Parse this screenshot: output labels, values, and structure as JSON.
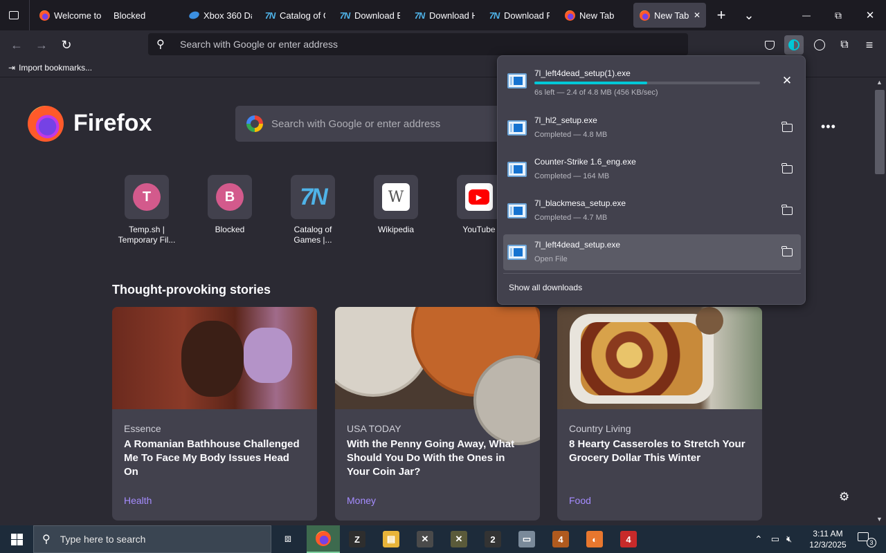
{
  "tabs": [
    {
      "label": "Welcome to",
      "icon": "firefox-icon"
    },
    {
      "label": "Blocked",
      "icon": "none"
    },
    {
      "label": "Xbox 360 Da",
      "icon": "xbox-icon"
    },
    {
      "label": "Catalog of G",
      "icon": "7n-icon"
    },
    {
      "label": "Download B",
      "icon": "7n-icon"
    },
    {
      "label": "Download H",
      "icon": "7n-icon"
    },
    {
      "label": "Download P",
      "icon": "7n-icon"
    },
    {
      "label": "New Tab",
      "icon": "firefox-icon"
    },
    {
      "label": "New Tab",
      "icon": "firefox-icon",
      "active": true
    }
  ],
  "window": {
    "minimize": "—",
    "maximize": "⧉",
    "close": "✕",
    "new_tab": "+",
    "tab_list": "⌄",
    "tab_close": "✕"
  },
  "nav": {
    "url_placeholder": "Search with Google or enter address"
  },
  "bookmarks": {
    "import_label": "Import bookmarks..."
  },
  "newtab": {
    "brand": "Firefox",
    "search_placeholder": "Search with Google or enter address",
    "top_sites": [
      {
        "label": "Temp.sh | Temporary Fil...",
        "letter": "T"
      },
      {
        "label": "Blocked",
        "letter": "B"
      },
      {
        "label": "Catalog of Games |...",
        "letter": "7N"
      },
      {
        "label": "Wikipedia",
        "letter": "W"
      },
      {
        "label": "YouTube",
        "letter": "▶"
      }
    ],
    "stories_heading": "Thought-provoking stories",
    "stories": [
      {
        "source": "Essence",
        "headline": "A Romanian Bathhouse Challenged Me To Face My Body Issues Head On",
        "category": "Health"
      },
      {
        "source": "USA TODAY",
        "headline": "With the Penny Going Away, What Should You Do With the Ones in Your Coin Jar?",
        "category": "Money"
      },
      {
        "source": "Country Living",
        "headline": "8 Hearty Casseroles to Stretch Your Grocery Dollar This Winter",
        "category": "Food"
      }
    ]
  },
  "downloads": {
    "items": [
      {
        "name": "7l_left4dead_setup(1).exe",
        "status": "6s left — 2.4 of 4.8 MB (456 KB/sec)",
        "progress": 0.5,
        "action": "cancel"
      },
      {
        "name": "7l_hl2_setup.exe",
        "status": "Completed — 4.8 MB",
        "action": "folder"
      },
      {
        "name": "Counter-Strike 1.6_eng.exe",
        "status": "Completed — 164 MB",
        "action": "folder"
      },
      {
        "name": "7l_blackmesa_setup.exe",
        "status": "Completed — 4.7 MB",
        "action": "folder"
      },
      {
        "name": "7l_left4dead_setup.exe",
        "status": "Open File",
        "action": "folder"
      }
    ],
    "show_all": "Show all downloads",
    "progress_color": "#00c8d7"
  },
  "taskbar": {
    "search_placeholder": "Type here to search",
    "time": "3:11 AM",
    "date": "12/3/2025",
    "notification_count": "3",
    "apps": [
      {
        "label": "Z",
        "name": "7zip-icon",
        "color": "#2e2e2e"
      },
      {
        "label": "▤",
        "name": "file-explorer-icon",
        "color": "#e8b43a"
      },
      {
        "label": "✕",
        "name": "xbox-360-icon",
        "color": "#4a4a4a"
      },
      {
        "label": "✕",
        "name": "xbox-icon",
        "color": "#5a5a3a"
      },
      {
        "label": "2",
        "name": "hl2-icon",
        "color": "#333"
      },
      {
        "label": "▭",
        "name": "paint-icon",
        "color": "#7a8a9a"
      },
      {
        "label": "4",
        "name": "l4d-icon",
        "color": "#b05a1e"
      },
      {
        "label": "◐",
        "name": "portal-icon",
        "color": "#e8772e"
      },
      {
        "label": "4",
        "name": "l4d2-icon",
        "color": "#c82a2a"
      }
    ]
  }
}
